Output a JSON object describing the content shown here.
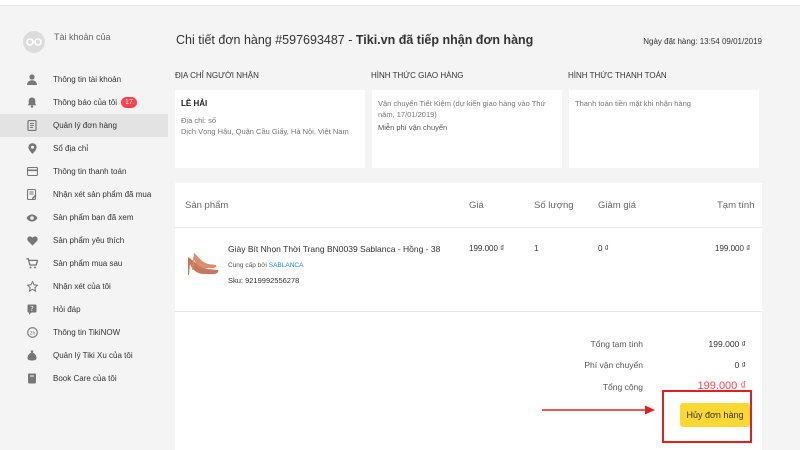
{
  "sidebar": {
    "account_label": "Tài khoản của",
    "items": [
      {
        "label": "Thông tin tài khoản",
        "icon": "user-icon"
      },
      {
        "label": "Thông báo của tôi",
        "icon": "bell-icon",
        "badge": "17"
      },
      {
        "label": "Quản lý đơn hàng",
        "icon": "order-list-icon",
        "active": true
      },
      {
        "label": "Sổ địa chỉ",
        "icon": "location-pin-icon"
      },
      {
        "label": "Thông tin thanh toán",
        "icon": "credit-card-icon"
      },
      {
        "label": "Nhận xét sản phẩm đã mua",
        "icon": "review-edit-icon"
      },
      {
        "label": "Sản phẩm bạn đã xem",
        "icon": "eye-icon"
      },
      {
        "label": "Sản phẩm yêu thích",
        "icon": "heart-icon"
      },
      {
        "label": "Sản phẩm mua sau",
        "icon": "cart-icon"
      },
      {
        "label": "Nhận xét của tôi",
        "icon": "star-icon"
      },
      {
        "label": "Hỏi đáp",
        "icon": "question-icon"
      },
      {
        "label": "Thông tin TikiNOW",
        "icon": "tikinow-icon"
      },
      {
        "label": "Quản lý Tiki Xu của tôi",
        "icon": "coin-bag-icon"
      },
      {
        "label": "Book Care của tôi",
        "icon": "book-icon"
      }
    ]
  },
  "order": {
    "title_prefix": "Chi tiết đơn hàng ",
    "code": "#597693487",
    "separator": " - ",
    "status": "Tiki.vn đã tiếp nhận đơn hàng",
    "date": "Ngày đặt hàng: 13:54 09/01/2019"
  },
  "info": {
    "address": {
      "label": "ĐỊA CHỈ NGƯỜI NHẬN",
      "name": "LÊ HẢI",
      "line1": "Địa chỉ: số",
      "line2": "Dịch Vọng Hậu, Quận Cầu Giấy, Hà Nội, Việt Nam"
    },
    "shipping": {
      "label": "HÌNH THỨC GIAO HÀNG",
      "line1": "Vận chuyển Tiết Kiệm (dự kiến giao hàng vào Thứ",
      "line2": "năm, 17/01/2019)",
      "line3": "Miễn phí vận chuyển"
    },
    "payment": {
      "label": "HÌNH THỨC THANH TOÁN",
      "line1": "Thanh toán tiền mặt khi nhận hàng"
    }
  },
  "table": {
    "headers": {
      "product": "Sản phẩm",
      "price": "Giá",
      "qty": "Số lượng",
      "discount": "Giảm giá",
      "subtotal": "Tạm tính"
    },
    "row": {
      "name": "Giày Bít Nhọn Thời Trang BN0039 Sablanca - Hồng - 38",
      "supplier_prefix": "Cung cấp bởi ",
      "supplier": "SABLANCA",
      "sku": "Sku: 9219992556278",
      "price": "199.000 ₫",
      "qty": "1",
      "discount": "0 ₫",
      "subtotal": "199.000 ₫"
    }
  },
  "summary": {
    "subtotal_label": "Tổng tạm tính",
    "subtotal_value": "199.000 ₫",
    "shipping_label": "Phí vận chuyển",
    "shipping_value": "0 ₫",
    "total_label": "Tổng cộng",
    "total_value": "199.000 ₫"
  },
  "actions": {
    "cancel_label": "Hủy đơn hàng"
  },
  "colors": {
    "accent_yellow": "#fdd835",
    "highlight_red": "#e02020",
    "badge_red": "#ff424e",
    "link_blue": "#1a82d6"
  }
}
